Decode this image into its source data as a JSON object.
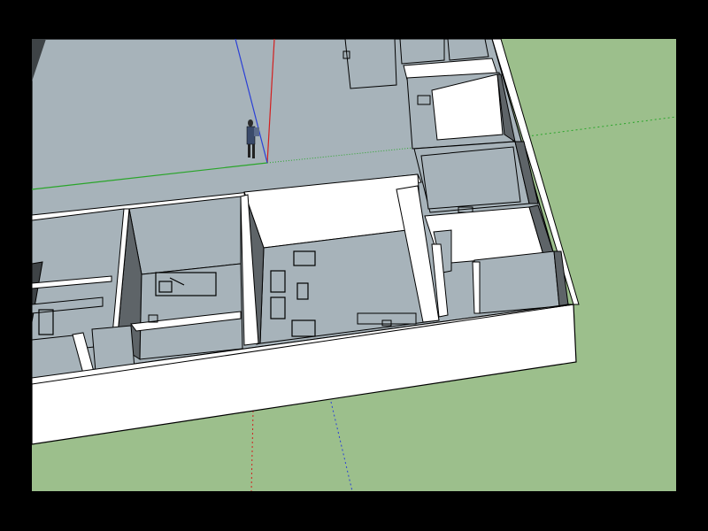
{
  "app": {
    "type": "3d-modeling-viewport"
  },
  "scene": {
    "colors": {
      "background_letterbox": "#000000",
      "ground": "#9cbf8c",
      "floor": "#a7b3ba",
      "wall_top": "#ffffff",
      "wall_face_light": "#ffffff",
      "wall_face_shaded": "#8e979c",
      "wall_face_dark": "#5e6468",
      "edge": "#000000",
      "axis_red": "#d21f1f",
      "axis_green": "#2aa52a",
      "axis_blue": "#2a3fd6"
    },
    "axes": [
      {
        "name": "red-axis",
        "color_key": "axis_red"
      },
      {
        "name": "green-axis",
        "color_key": "axis_green"
      },
      {
        "name": "blue-axis",
        "color_key": "axis_blue"
      }
    ],
    "figure": {
      "name": "scale-figure",
      "icon": "person-icon"
    },
    "objects": {
      "furniture": [
        "bed-icon",
        "desk-icon",
        "chair-icon",
        "table-icon"
      ]
    }
  }
}
